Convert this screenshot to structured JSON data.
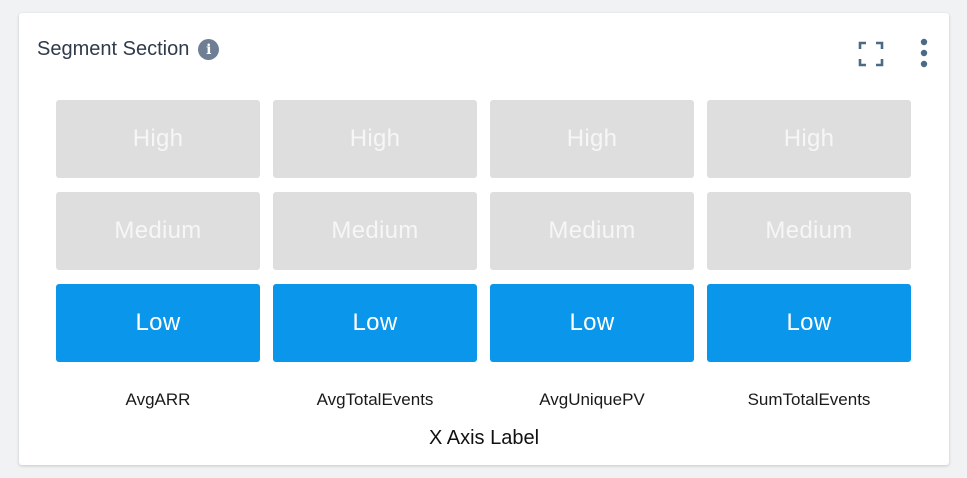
{
  "header": {
    "title": "Segment Section",
    "info_glyph": "i",
    "icons": [
      "info-icon",
      "fullscreen-icon",
      "more-vertical-icon"
    ]
  },
  "colors": {
    "active": "#0a96ea",
    "inactive": "#dedede"
  },
  "chart_data": {
    "type": "heatmap",
    "title": "Segment Section",
    "xlabel": "X Axis Label",
    "ylabel": "",
    "categories": [
      "AvgARR",
      "AvgTotalEvents",
      "AvgUniquePV",
      "SumTotalEvents"
    ],
    "levels": [
      "High",
      "Medium",
      "Low"
    ],
    "selected": [
      "Low",
      "Low",
      "Low",
      "Low"
    ]
  }
}
